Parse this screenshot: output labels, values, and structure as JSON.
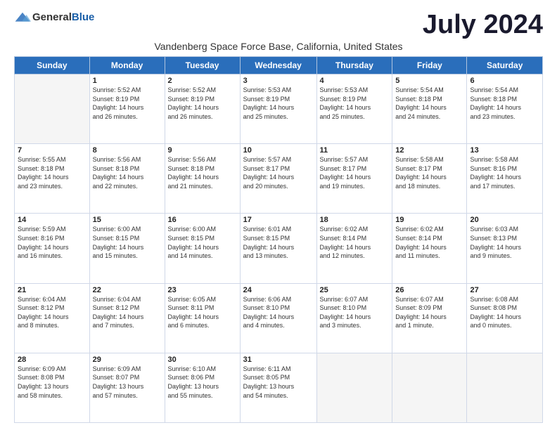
{
  "logo": {
    "general": "General",
    "blue": "Blue"
  },
  "title": "July 2024",
  "location": "Vandenberg Space Force Base, California, United States",
  "days_of_week": [
    "Sunday",
    "Monday",
    "Tuesday",
    "Wednesday",
    "Thursday",
    "Friday",
    "Saturday"
  ],
  "weeks": [
    [
      {
        "day": "",
        "info": ""
      },
      {
        "day": "1",
        "info": "Sunrise: 5:52 AM\nSunset: 8:19 PM\nDaylight: 14 hours\nand 26 minutes."
      },
      {
        "day": "2",
        "info": "Sunrise: 5:52 AM\nSunset: 8:19 PM\nDaylight: 14 hours\nand 26 minutes."
      },
      {
        "day": "3",
        "info": "Sunrise: 5:53 AM\nSunset: 8:19 PM\nDaylight: 14 hours\nand 25 minutes."
      },
      {
        "day": "4",
        "info": "Sunrise: 5:53 AM\nSunset: 8:19 PM\nDaylight: 14 hours\nand 25 minutes."
      },
      {
        "day": "5",
        "info": "Sunrise: 5:54 AM\nSunset: 8:18 PM\nDaylight: 14 hours\nand 24 minutes."
      },
      {
        "day": "6",
        "info": "Sunrise: 5:54 AM\nSunset: 8:18 PM\nDaylight: 14 hours\nand 23 minutes."
      }
    ],
    [
      {
        "day": "7",
        "info": "Sunrise: 5:55 AM\nSunset: 8:18 PM\nDaylight: 14 hours\nand 23 minutes."
      },
      {
        "day": "8",
        "info": "Sunrise: 5:56 AM\nSunset: 8:18 PM\nDaylight: 14 hours\nand 22 minutes."
      },
      {
        "day": "9",
        "info": "Sunrise: 5:56 AM\nSunset: 8:18 PM\nDaylight: 14 hours\nand 21 minutes."
      },
      {
        "day": "10",
        "info": "Sunrise: 5:57 AM\nSunset: 8:17 PM\nDaylight: 14 hours\nand 20 minutes."
      },
      {
        "day": "11",
        "info": "Sunrise: 5:57 AM\nSunset: 8:17 PM\nDaylight: 14 hours\nand 19 minutes."
      },
      {
        "day": "12",
        "info": "Sunrise: 5:58 AM\nSunset: 8:17 PM\nDaylight: 14 hours\nand 18 minutes."
      },
      {
        "day": "13",
        "info": "Sunrise: 5:58 AM\nSunset: 8:16 PM\nDaylight: 14 hours\nand 17 minutes."
      }
    ],
    [
      {
        "day": "14",
        "info": "Sunrise: 5:59 AM\nSunset: 8:16 PM\nDaylight: 14 hours\nand 16 minutes."
      },
      {
        "day": "15",
        "info": "Sunrise: 6:00 AM\nSunset: 8:15 PM\nDaylight: 14 hours\nand 15 minutes."
      },
      {
        "day": "16",
        "info": "Sunrise: 6:00 AM\nSunset: 8:15 PM\nDaylight: 14 hours\nand 14 minutes."
      },
      {
        "day": "17",
        "info": "Sunrise: 6:01 AM\nSunset: 8:15 PM\nDaylight: 14 hours\nand 13 minutes."
      },
      {
        "day": "18",
        "info": "Sunrise: 6:02 AM\nSunset: 8:14 PM\nDaylight: 14 hours\nand 12 minutes."
      },
      {
        "day": "19",
        "info": "Sunrise: 6:02 AM\nSunset: 8:14 PM\nDaylight: 14 hours\nand 11 minutes."
      },
      {
        "day": "20",
        "info": "Sunrise: 6:03 AM\nSunset: 8:13 PM\nDaylight: 14 hours\nand 9 minutes."
      }
    ],
    [
      {
        "day": "21",
        "info": "Sunrise: 6:04 AM\nSunset: 8:12 PM\nDaylight: 14 hours\nand 8 minutes."
      },
      {
        "day": "22",
        "info": "Sunrise: 6:04 AM\nSunset: 8:12 PM\nDaylight: 14 hours\nand 7 minutes."
      },
      {
        "day": "23",
        "info": "Sunrise: 6:05 AM\nSunset: 8:11 PM\nDaylight: 14 hours\nand 6 minutes."
      },
      {
        "day": "24",
        "info": "Sunrise: 6:06 AM\nSunset: 8:10 PM\nDaylight: 14 hours\nand 4 minutes."
      },
      {
        "day": "25",
        "info": "Sunrise: 6:07 AM\nSunset: 8:10 PM\nDaylight: 14 hours\nand 3 minutes."
      },
      {
        "day": "26",
        "info": "Sunrise: 6:07 AM\nSunset: 8:09 PM\nDaylight: 14 hours\nand 1 minute."
      },
      {
        "day": "27",
        "info": "Sunrise: 6:08 AM\nSunset: 8:08 PM\nDaylight: 14 hours\nand 0 minutes."
      }
    ],
    [
      {
        "day": "28",
        "info": "Sunrise: 6:09 AM\nSunset: 8:08 PM\nDaylight: 13 hours\nand 58 minutes."
      },
      {
        "day": "29",
        "info": "Sunrise: 6:09 AM\nSunset: 8:07 PM\nDaylight: 13 hours\nand 57 minutes."
      },
      {
        "day": "30",
        "info": "Sunrise: 6:10 AM\nSunset: 8:06 PM\nDaylight: 13 hours\nand 55 minutes."
      },
      {
        "day": "31",
        "info": "Sunrise: 6:11 AM\nSunset: 8:05 PM\nDaylight: 13 hours\nand 54 minutes."
      },
      {
        "day": "",
        "info": ""
      },
      {
        "day": "",
        "info": ""
      },
      {
        "day": "",
        "info": ""
      }
    ]
  ]
}
